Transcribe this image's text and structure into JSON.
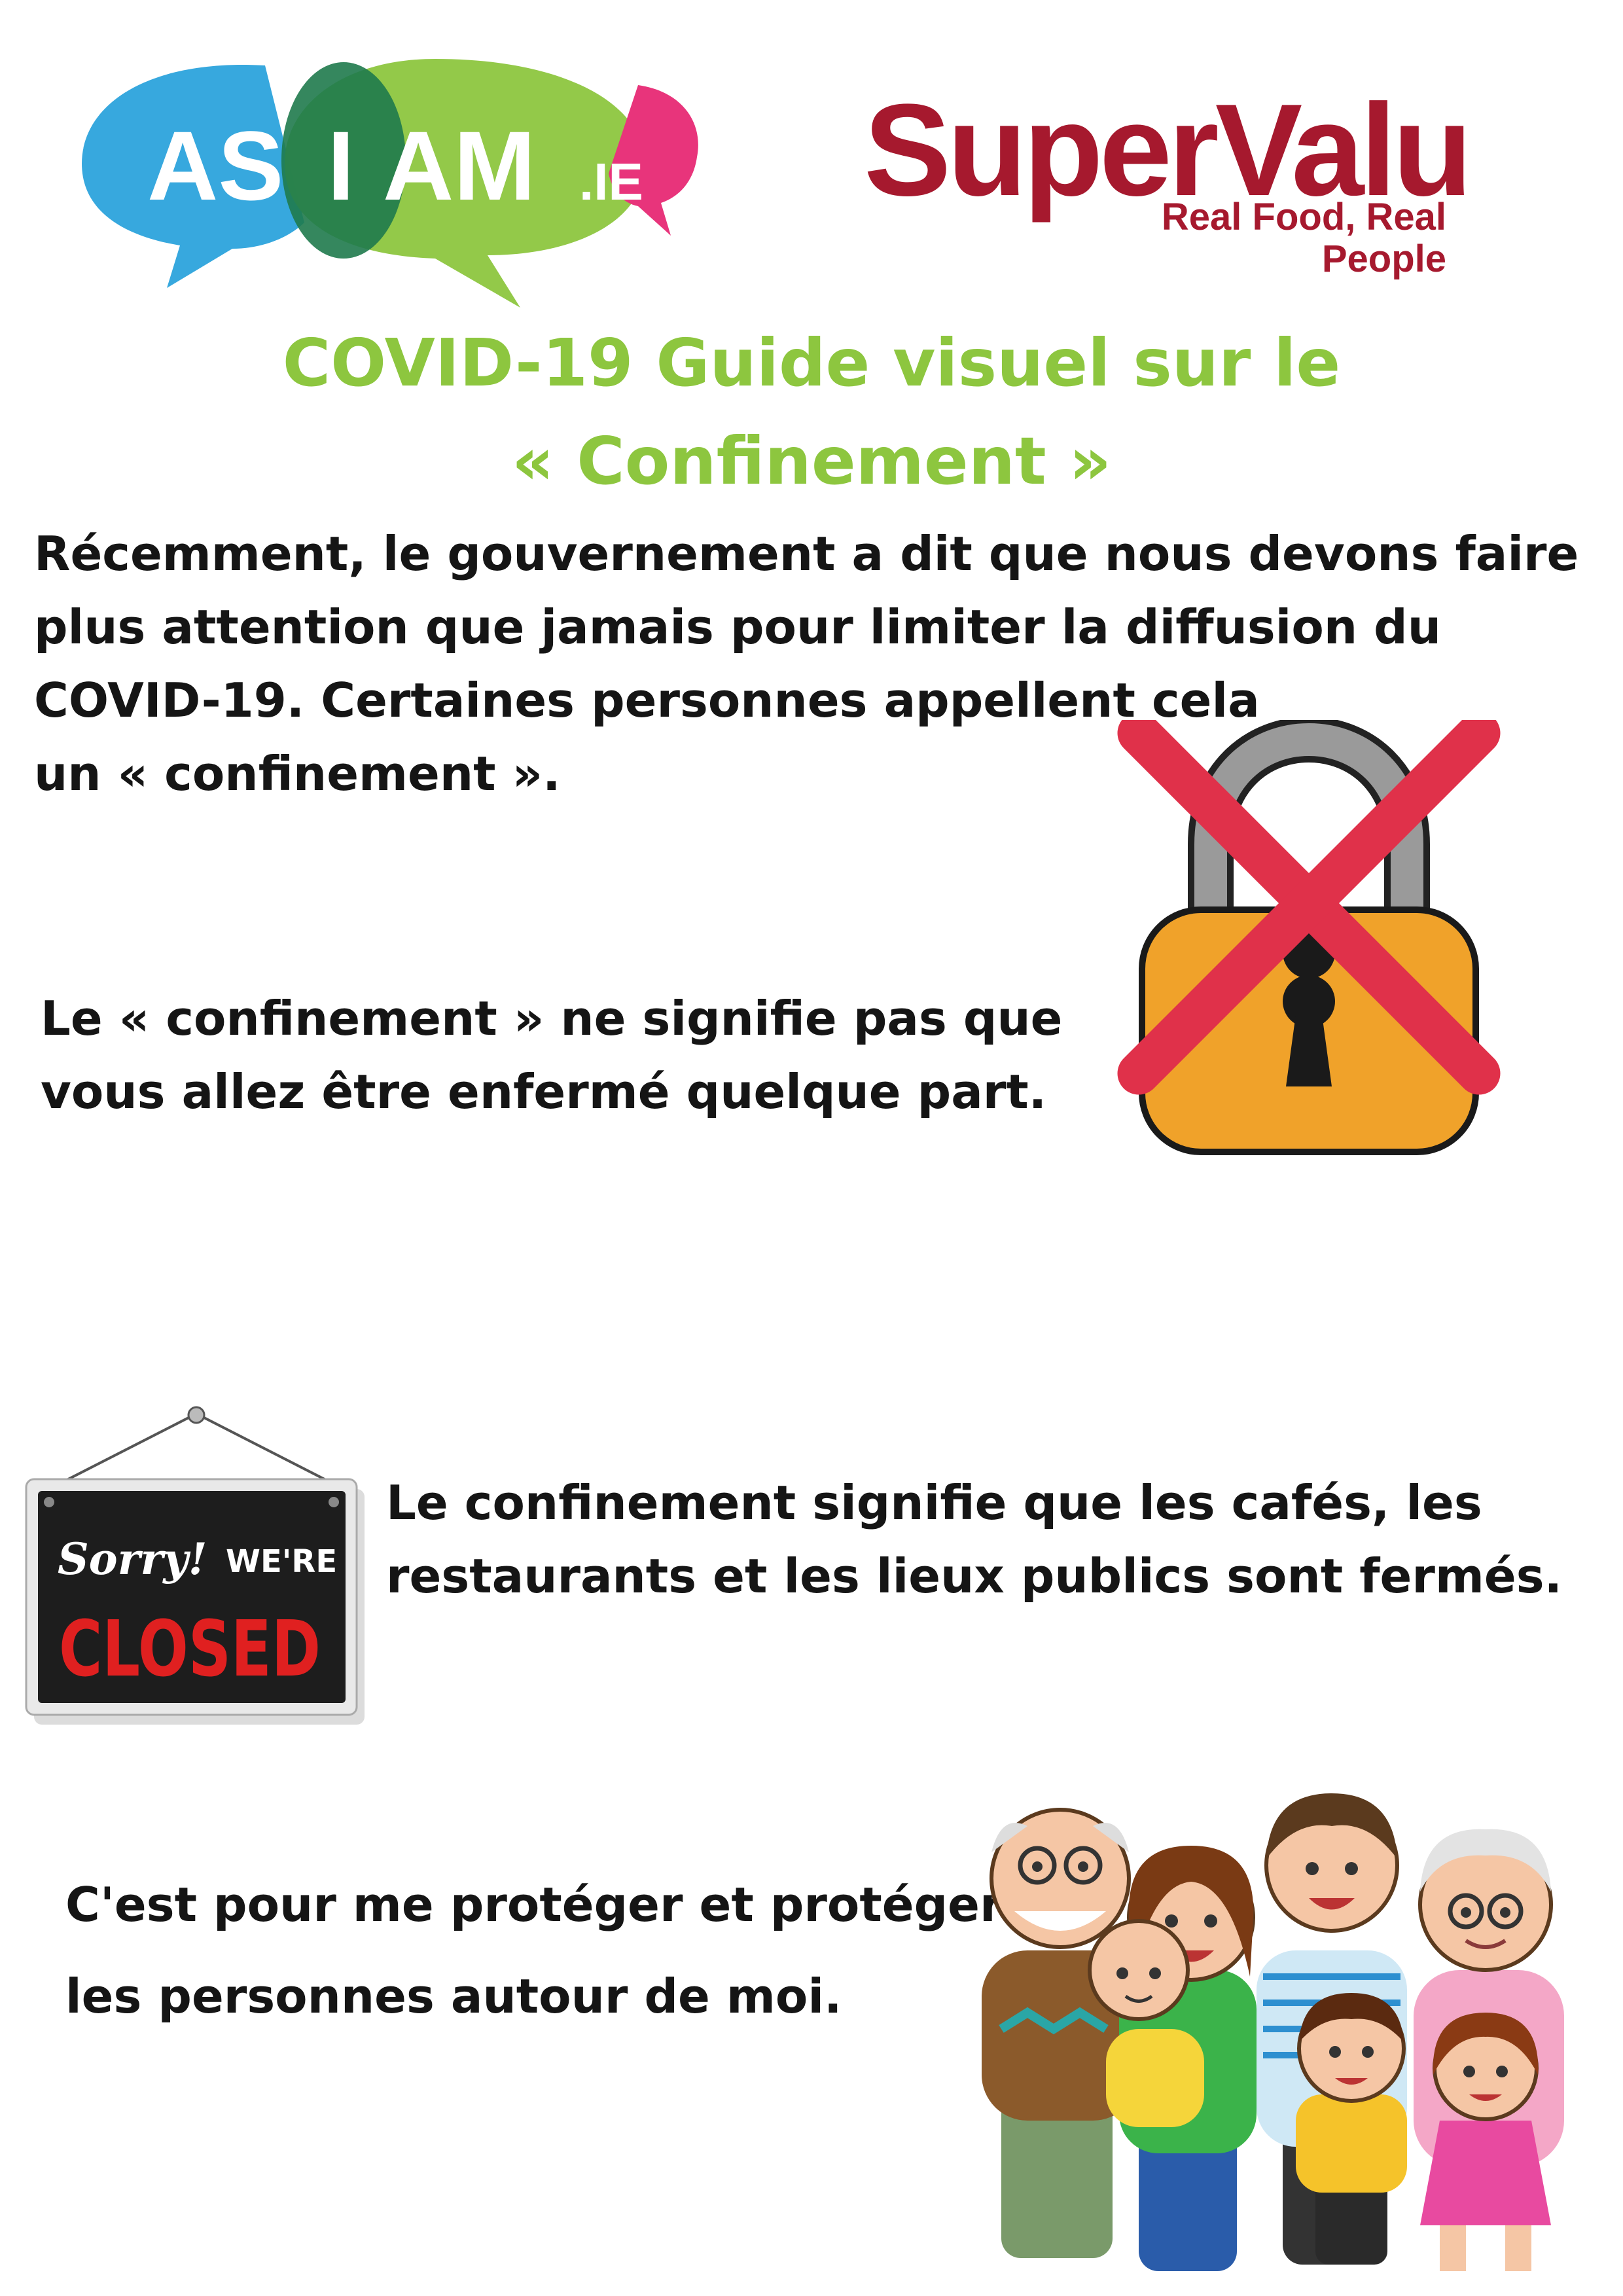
{
  "logos": {
    "asiam": {
      "letters_left": "AS",
      "letter_mid": "I",
      "letters_right": "AM",
      "suffix": ".IE"
    },
    "supervalu": {
      "name": "SuperValu",
      "tagline": "Real Food, Real People"
    }
  },
  "title": {
    "line1": "COVID-19 Guide visuel sur le",
    "line2": "« Confinement »"
  },
  "intro": {
    "line1": "Récemment, le gouvernement a dit que nous  devons faire",
    "line2": "plus attention que jamais pour limiter la diffusion du",
    "line3": "COVID-19. Certaines personnes appellent  cela",
    "line4": "un « confinement »."
  },
  "section_lock": {
    "line1": "Le « confinement » ne signifie pas que",
    "line2": "vous allez être enfermé quelque part.",
    "icon": "crossed-padlock-icon"
  },
  "section_closed": {
    "sign_sorry": "Sorry!",
    "sign_were": "WE'RE",
    "sign_closed": "CLOSED",
    "line1": "Le confinement signifie que les cafés, les",
    "line2": "restaurants et les lieux publics sont fermés."
  },
  "section_family": {
    "line1": "C'est pour me protéger et protéger",
    "line2": "les personnes autour de moi."
  },
  "colors": {
    "title_green": "#8dc63f",
    "asiam_blue": "#2ca3dc",
    "asiam_green": "#8dc63f",
    "asiam_dark": "#1f7a4c",
    "asiam_pink": "#e8347b",
    "supervalu_red": "#a6192e",
    "cross_red": "#e0314a",
    "lock_orange": "#f0a22a"
  }
}
